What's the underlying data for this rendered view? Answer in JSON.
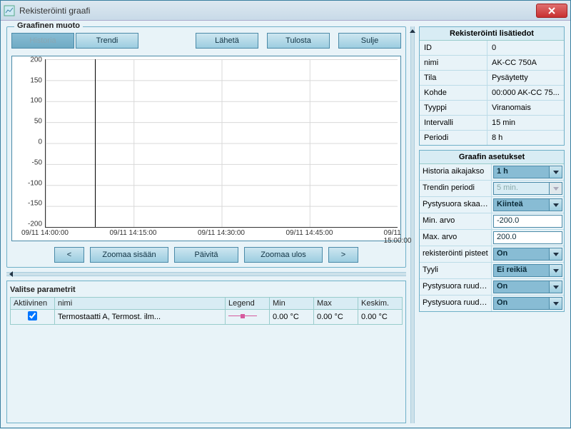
{
  "window": {
    "title": "Rekisteröinti graafi"
  },
  "groupbox": {
    "title": "Graafinen muoto"
  },
  "mode": {
    "history": "Historia",
    "trend": "Trendi"
  },
  "actions": {
    "send": "Lähetä",
    "print": "Tulosta",
    "close": "Sulje"
  },
  "nav": {
    "prev": "<",
    "zoom_in": "Zoomaa sisään",
    "refresh": "Päivitä",
    "zoom_out": "Zoomaa ulos",
    "next": ">"
  },
  "params_title": "Valitse parametrit",
  "params_headers": {
    "active": "Aktiivinen",
    "name": "nimi",
    "legend": "Legend",
    "min": "Min",
    "max": "Max",
    "avg": "Keskim."
  },
  "params": [
    {
      "active": true,
      "name": "Termostaatti A, Termost. ilm...",
      "min": "0.00 °C",
      "max": "0.00 °C",
      "avg": "0.00 °C"
    }
  ],
  "info": {
    "title": "Rekisteröinti lisätiedot",
    "rows": [
      {
        "k": "ID",
        "v": "0"
      },
      {
        "k": "nimi",
        "v": "AK-CC 750A"
      },
      {
        "k": "Tila",
        "v": "Pysäytetty"
      },
      {
        "k": "Kohde",
        "v": "00:000 AK-CC 75..."
      },
      {
        "k": "Tyyppi",
        "v": "Viranomais"
      },
      {
        "k": "Intervalli",
        "v": "15 min"
      },
      {
        "k": "Periodi",
        "v": "8 h"
      }
    ]
  },
  "settings": {
    "title": "Graafin asetukset",
    "history_period": {
      "k": "Historia aikajakso",
      "v": "1 h"
    },
    "trend_period": {
      "k": "Trendin periodi",
      "v": "5 min."
    },
    "yscale": {
      "k": "Pystysuora skaal...",
      "v": "Kiinteä"
    },
    "min": {
      "k": "Min. arvo",
      "v": "-200.0"
    },
    "max": {
      "k": "Max. arvo",
      "v": "200.0"
    },
    "points": {
      "k": "rekisteröinti pisteet",
      "v": "On"
    },
    "style": {
      "k": "Tyyli",
      "v": "Ei reikiä"
    },
    "ygrid1": {
      "k": "Pystysuora ruudu...",
      "v": "On"
    },
    "ygrid2": {
      "k": "Pystysuora ruudu...",
      "v": "On"
    }
  },
  "chart_data": {
    "type": "line",
    "title": "",
    "xlabel": "",
    "ylabel": "",
    "ylim": [
      -200,
      200
    ],
    "y_ticks": [
      200.0,
      150.0,
      100.0,
      50.0,
      0.0,
      -50.0,
      -100.0,
      -150.0,
      -200.0
    ],
    "x_ticks": [
      "09/11 14:00:00",
      "09/11 14:15:00",
      "09/11 14:30:00",
      "09/11 14:45:00",
      "09/11 15:00:00"
    ],
    "series": [
      {
        "name": "Termostaatti A, Termost. ilm...",
        "color": "#d65a9e",
        "values": []
      }
    ],
    "cursor_x_fraction": 0.14
  }
}
